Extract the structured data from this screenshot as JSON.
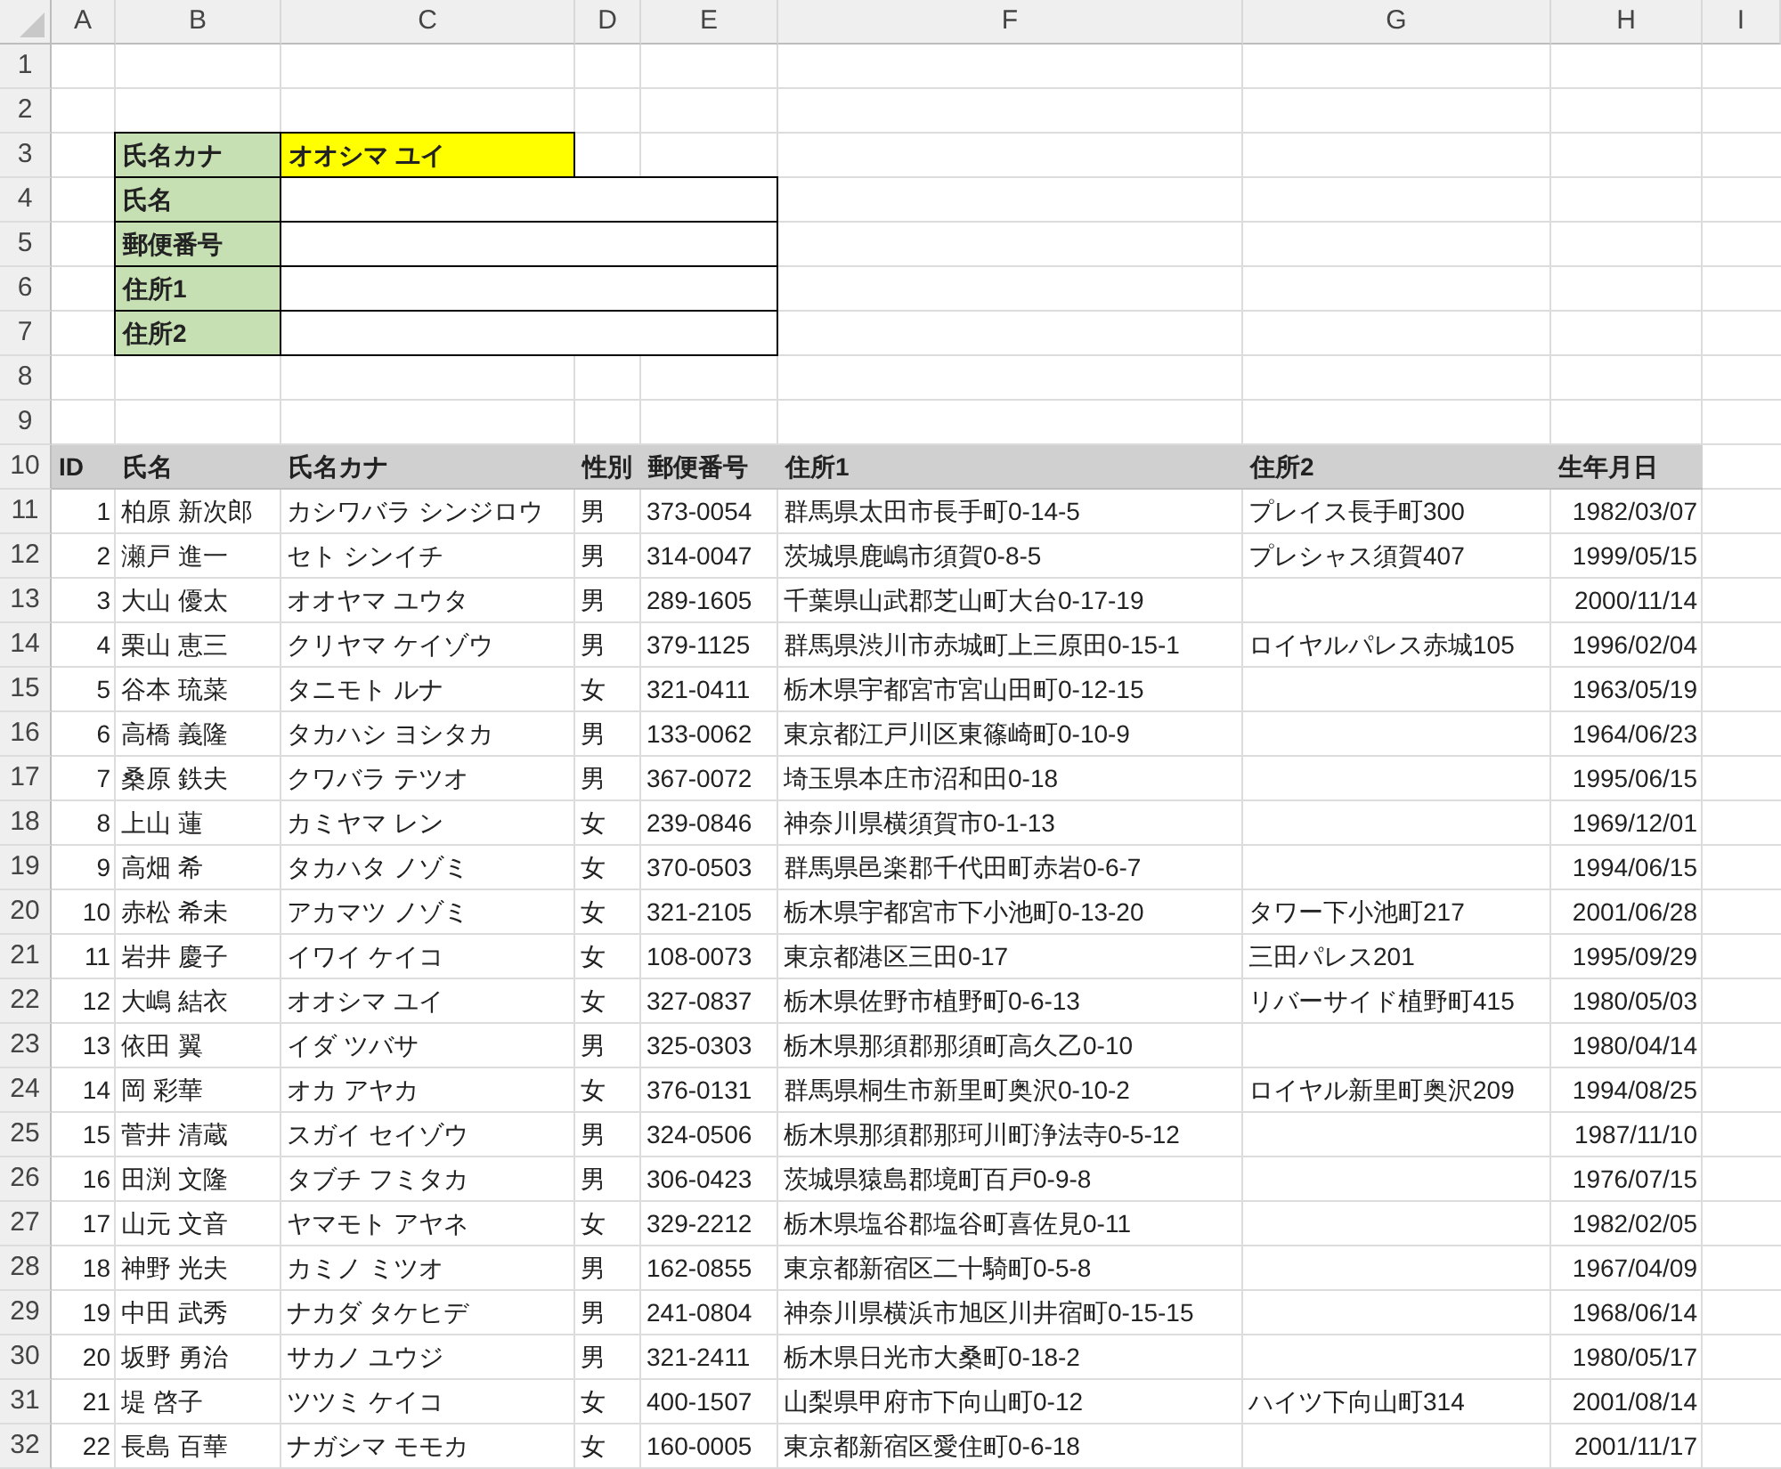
{
  "column_headers": [
    "A",
    "B",
    "C",
    "D",
    "E",
    "F",
    "G",
    "H",
    "I"
  ],
  "row_numbers": [
    "1",
    "2",
    "3",
    "4",
    "5",
    "6",
    "7",
    "8",
    "9",
    "10",
    "11",
    "12",
    "13",
    "14",
    "15",
    "16",
    "17",
    "18",
    "19",
    "20",
    "21",
    "22",
    "23",
    "24",
    "25",
    "26",
    "27",
    "28",
    "29",
    "30",
    "31",
    "32"
  ],
  "lookup_form": {
    "fields": [
      {
        "label": "氏名カナ",
        "value": "オオシマ ユイ",
        "highlighted": true
      },
      {
        "label": "氏名",
        "highlighted": false
      },
      {
        "label": "郵便番号",
        "highlighted": false
      },
      {
        "label": "住所1",
        "highlighted": false
      },
      {
        "label": "住所2",
        "highlighted": false
      }
    ]
  },
  "table": {
    "columns": [
      "ID",
      "氏名",
      "氏名カナ",
      "性別",
      "郵便番号",
      "住所1",
      "住所2",
      "生年月日"
    ],
    "rows": [
      {
        "id": "1",
        "name": "柏原 新次郎",
        "kana": "カシワバラ シンジロウ",
        "gender": "男",
        "zip": "373-0054",
        "address1": "群馬県太田市長手町0-14-5",
        "address2": "プレイス長手町300",
        "birthdate": "1982/03/07"
      },
      {
        "id": "2",
        "name": "瀬戸 進一",
        "kana": "セト シンイチ",
        "gender": "男",
        "zip": "314-0047",
        "address1": "茨城県鹿嶋市須賀0-8-5",
        "address2": "プレシャス須賀407",
        "birthdate": "1999/05/15"
      },
      {
        "id": "3",
        "name": "大山 優太",
        "kana": "オオヤマ ユウタ",
        "gender": "男",
        "zip": "289-1605",
        "address1": "千葉県山武郡芝山町大台0-17-19",
        "birthdate": "2000/11/14"
      },
      {
        "id": "4",
        "name": "栗山 恵三",
        "kana": "クリヤマ ケイゾウ",
        "gender": "男",
        "zip": "379-1125",
        "address1": "群馬県渋川市赤城町上三原田0-15-1",
        "address2": "ロイヤルパレス赤城105",
        "birthdate": "1996/02/04"
      },
      {
        "id": "5",
        "name": "谷本 琉菜",
        "kana": "タニモト ルナ",
        "gender": "女",
        "zip": "321-0411",
        "address1": "栃木県宇都宮市宮山田町0-12-15",
        "birthdate": "1963/05/19"
      },
      {
        "id": "6",
        "name": "高橋 義隆",
        "kana": "タカハシ ヨシタカ",
        "gender": "男",
        "zip": "133-0062",
        "address1": "東京都江戸川区東篠崎町0-10-9",
        "birthdate": "1964/06/23"
      },
      {
        "id": "7",
        "name": "桑原 鉄夫",
        "kana": "クワバラ テツオ",
        "gender": "男",
        "zip": "367-0072",
        "address1": "埼玉県本庄市沼和田0-18",
        "birthdate": "1995/06/15"
      },
      {
        "id": "8",
        "name": "上山 蓮",
        "kana": "カミヤマ レン",
        "gender": "女",
        "zip": "239-0846",
        "address1": "神奈川県横須賀市0-1-13",
        "birthdate": "1969/12/01"
      },
      {
        "id": "9",
        "name": "高畑 希",
        "kana": "タカハタ ノゾミ",
        "gender": "女",
        "zip": "370-0503",
        "address1": "群馬県邑楽郡千代田町赤岩0-6-7",
        "birthdate": "1994/06/15"
      },
      {
        "id": "10",
        "name": "赤松 希未",
        "kana": "アカマツ ノゾミ",
        "gender": "女",
        "zip": "321-2105",
        "address1": "栃木県宇都宮市下小池町0-13-20",
        "address2": "タワー下小池町217",
        "birthdate": "2001/06/28"
      },
      {
        "id": "11",
        "name": "岩井 慶子",
        "kana": "イワイ ケイコ",
        "gender": "女",
        "zip": "108-0073",
        "address1": "東京都港区三田0-17",
        "address2": "三田パレス201",
        "birthdate": "1995/09/29"
      },
      {
        "id": "12",
        "name": "大嶋 結衣",
        "kana": "オオシマ ユイ",
        "gender": "女",
        "zip": "327-0837",
        "address1": "栃木県佐野市植野町0-6-13",
        "address2": "リバーサイド植野町415",
        "birthdate": "1980/05/03"
      },
      {
        "id": "13",
        "name": "依田 翼",
        "kana": "イダ ツバサ",
        "gender": "男",
        "zip": "325-0303",
        "address1": "栃木県那須郡那須町高久乙0-10",
        "birthdate": "1980/04/14"
      },
      {
        "id": "14",
        "name": "岡 彩華",
        "kana": "オカ アヤカ",
        "gender": "女",
        "zip": "376-0131",
        "address1": "群馬県桐生市新里町奥沢0-10-2",
        "address2": "ロイヤル新里町奥沢209",
        "birthdate": "1994/08/25"
      },
      {
        "id": "15",
        "name": "菅井 清蔵",
        "kana": "スガイ セイゾウ",
        "gender": "男",
        "zip": "324-0506",
        "address1": "栃木県那須郡那珂川町浄法寺0-5-12",
        "birthdate": "1987/11/10"
      },
      {
        "id": "16",
        "name": "田渕 文隆",
        "kana": "タブチ フミタカ",
        "gender": "男",
        "zip": "306-0423",
        "address1": "茨城県猿島郡境町百戸0-9-8",
        "birthdate": "1976/07/15"
      },
      {
        "id": "17",
        "name": "山元 文音",
        "kana": "ヤマモト アヤネ",
        "gender": "女",
        "zip": "329-2212",
        "address1": "栃木県塩谷郡塩谷町喜佐見0-11",
        "birthdate": "1982/02/05"
      },
      {
        "id": "18",
        "name": "神野 光夫",
        "kana": "カミノ ミツオ",
        "gender": "男",
        "zip": "162-0855",
        "address1": "東京都新宿区二十騎町0-5-8",
        "birthdate": "1967/04/09"
      },
      {
        "id": "19",
        "name": "中田 武秀",
        "kana": "ナカダ タケヒデ",
        "gender": "男",
        "zip": "241-0804",
        "address1": "神奈川県横浜市旭区川井宿町0-15-15",
        "birthdate": "1968/06/14"
      },
      {
        "id": "20",
        "name": "坂野 勇治",
        "kana": "サカノ ユウジ",
        "gender": "男",
        "zip": "321-2411",
        "address1": "栃木県日光市大桑町0-18-2",
        "birthdate": "1980/05/17"
      },
      {
        "id": "21",
        "name": "堤 啓子",
        "kana": "ツツミ ケイコ",
        "gender": "女",
        "zip": "400-1507",
        "address1": "山梨県甲府市下向山町0-12",
        "address2": "ハイツ下向山町314",
        "birthdate": "2001/08/14"
      },
      {
        "id": "22",
        "name": "長島 百華",
        "kana": "ナガシマ モモカ",
        "gender": "女",
        "zip": "160-0005",
        "address1": "東京都新宿区愛住町0-6-18",
        "birthdate": "2001/11/17"
      }
    ]
  }
}
